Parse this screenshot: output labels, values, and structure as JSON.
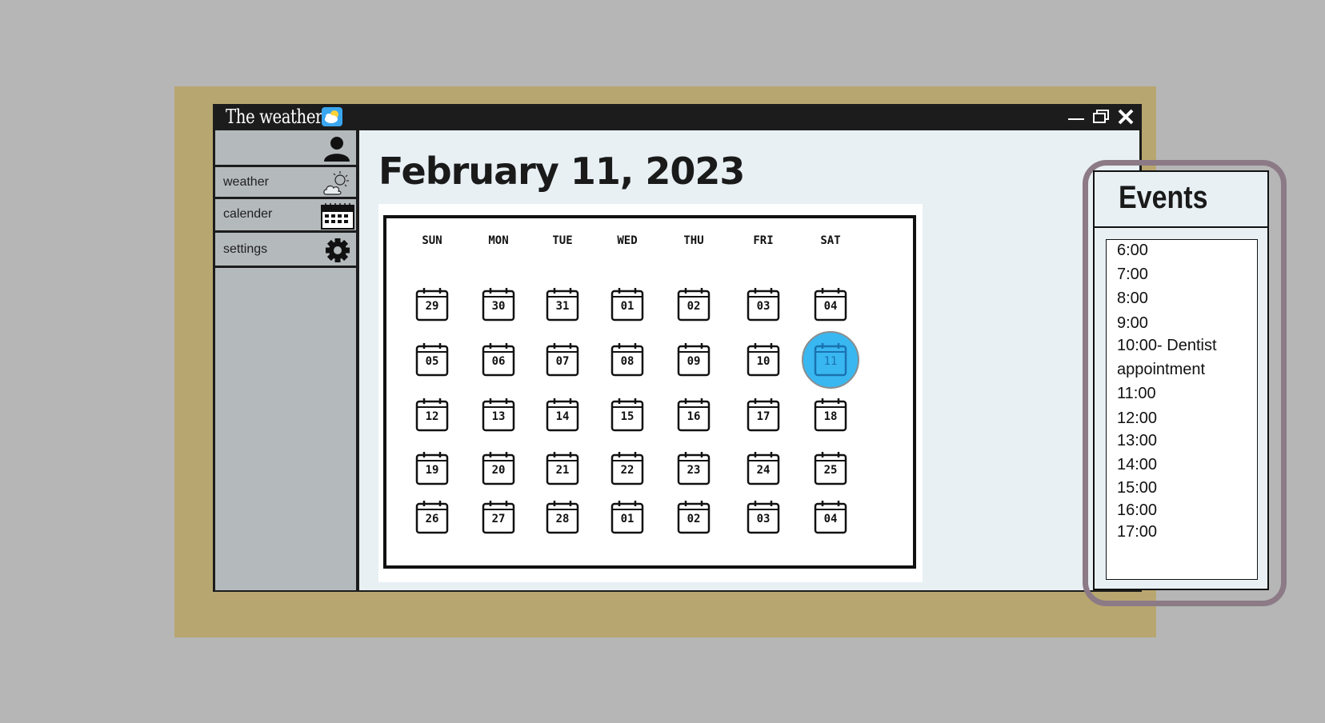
{
  "window": {
    "title": "The weather"
  },
  "sidebar": {
    "items": [
      {
        "label": "",
        "icon": "user-icon"
      },
      {
        "label": "weather",
        "icon": "weather-icon"
      },
      {
        "label": "calender",
        "icon": "calendar-icon"
      },
      {
        "label": "settings",
        "icon": "gear-icon"
      }
    ]
  },
  "main": {
    "date_title": "February 11, 2023",
    "weekdays": [
      "SUN",
      "MON",
      "TUE",
      "WED",
      "THU",
      "FRI",
      "SAT"
    ],
    "weeks": [
      [
        "29",
        "30",
        "31",
        "01",
        "02",
        "03",
        "04"
      ],
      [
        "05",
        "06",
        "07",
        "08",
        "09",
        "10",
        "11"
      ],
      [
        "12",
        "13",
        "14",
        "15",
        "16",
        "17",
        "18"
      ],
      [
        "19",
        "20",
        "21",
        "22",
        "23",
        "24",
        "25"
      ],
      [
        "26",
        "27",
        "28",
        "01",
        "02",
        "03",
        "04"
      ]
    ],
    "selected_day": "11",
    "accent_color": "#39b7f0"
  },
  "events": {
    "title": "Events",
    "items": [
      "6:00",
      "7:00",
      "8:00",
      "9:00",
      "10:00- Dentist",
      "appointment",
      "11:00",
      "12:00",
      "13:00",
      "14:00",
      "15:00",
      "16:00",
      "17:00"
    ]
  }
}
